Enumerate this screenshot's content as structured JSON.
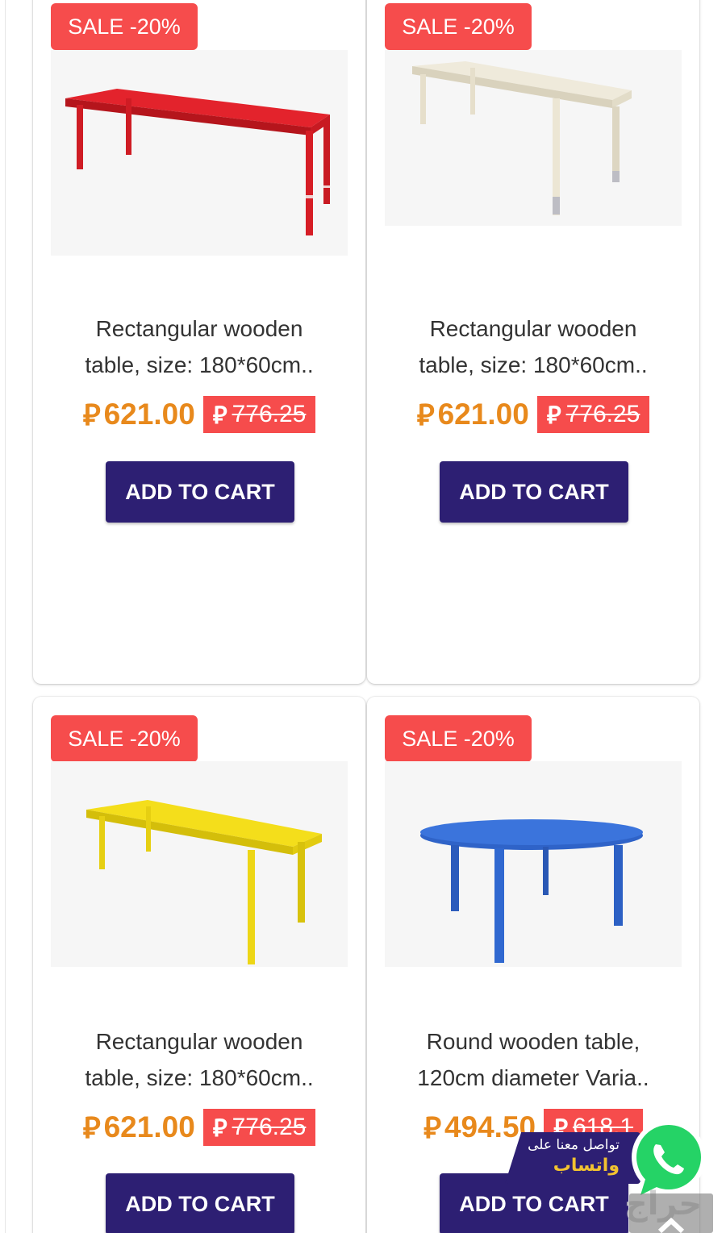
{
  "products": [
    {
      "sale_badge": "SALE -20%",
      "image": "red-rectangular-table",
      "title_line1": "Rectangular wooden",
      "title_line2": "table, size: 180*60cm..",
      "currency_symbol": "⃁",
      "price": "621.00",
      "old_price": "776.25",
      "button": "ADD TO CART"
    },
    {
      "sale_badge": "SALE -20%",
      "image": "cream-rectangular-table",
      "title_line1": "Rectangular wooden",
      "title_line2": "table, size: 180*60cm..",
      "currency_symbol": "⃁",
      "price": "621.00",
      "old_price": "776.25",
      "button": "ADD TO CART"
    },
    {
      "sale_badge": "SALE -20%",
      "image": "yellow-rectangular-table",
      "title_line1": "Rectangular wooden",
      "title_line2": "table, size: 180*60cm..",
      "currency_symbol": "⃁",
      "price": "621.00",
      "old_price": "776.25",
      "button": "ADD TO CART"
    },
    {
      "sale_badge": "SALE -20%",
      "image": "blue-round-table",
      "title_line1": "Round wooden table,",
      "title_line2": "120cm diameter Varia..",
      "currency_symbol": "⃁",
      "price": "494.50",
      "old_price": "618.1",
      "button": "ADD TO CART"
    }
  ],
  "whatsapp": {
    "line1": "تواصل معنا على",
    "line2": "واتساب",
    "icon": "whatsapp-icon"
  },
  "scroll_top": {
    "icon": "chevron-up-icon"
  },
  "watermark": "حراج",
  "colors": {
    "sale_red": "#f64c4c",
    "price_orange": "#e8891c",
    "button_indigo": "#2d1f73",
    "whatsapp_green": "#25d366"
  }
}
